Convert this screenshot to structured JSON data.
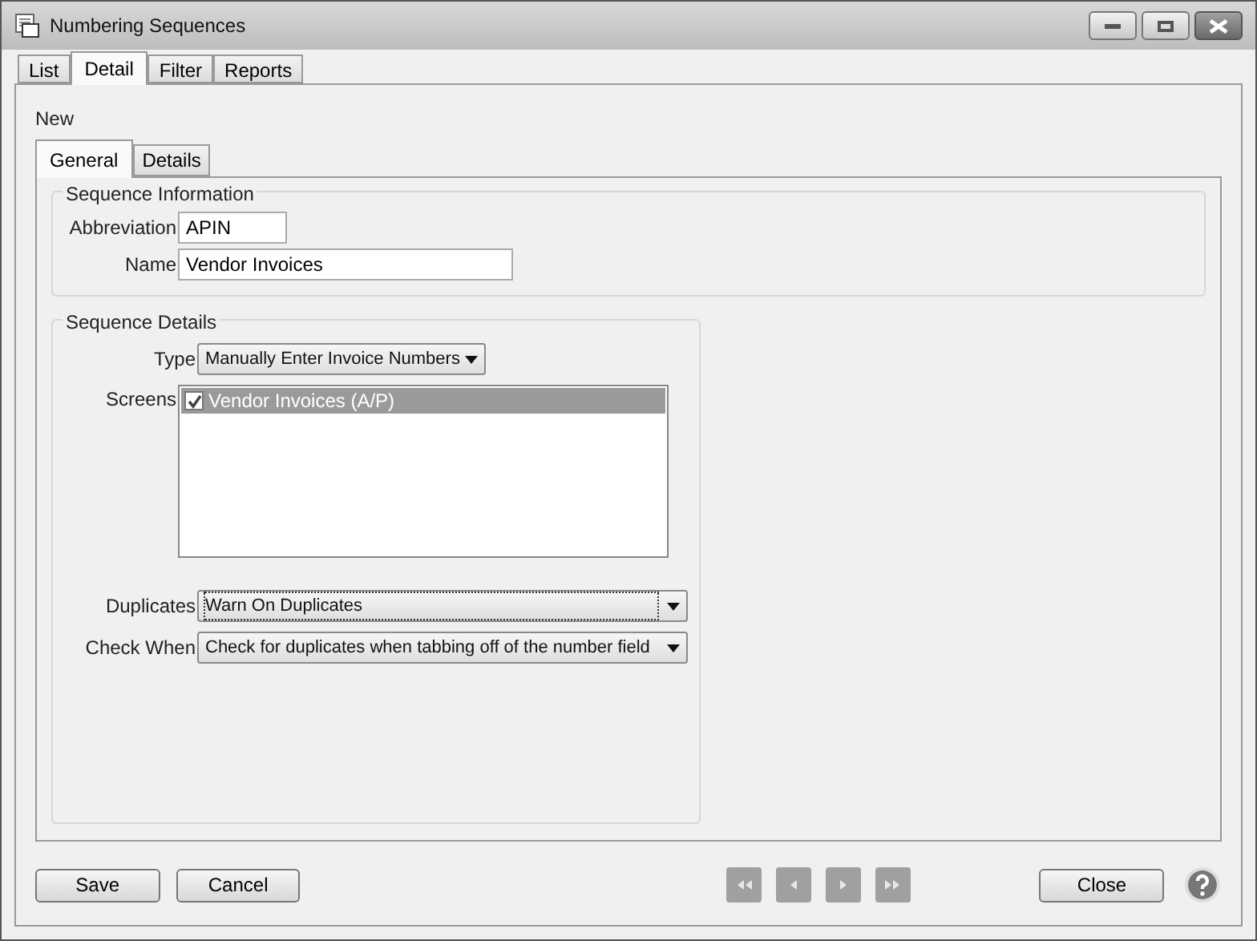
{
  "window": {
    "title": "Numbering Sequences"
  },
  "tabs": [
    {
      "label": "List",
      "selected": false
    },
    {
      "label": "Detail",
      "selected": true
    },
    {
      "label": "Filter",
      "selected": false
    },
    {
      "label": "Reports",
      "selected": false
    }
  ],
  "record_status": "New",
  "subtabs": [
    {
      "label": "General",
      "selected": true
    },
    {
      "label": "Details",
      "selected": false
    }
  ],
  "sequence_information": {
    "title": "Sequence Information",
    "abbreviation": {
      "label": "Abbreviation",
      "value": "APIN"
    },
    "name": {
      "label": "Name",
      "value": "Vendor Invoices"
    }
  },
  "sequence_details": {
    "title": "Sequence Details",
    "type": {
      "label": "Type",
      "value": "Manually Enter Invoice Numbers"
    },
    "screens": {
      "label": "Screens",
      "items": [
        {
          "label": "Vendor Invoices (A/P)",
          "checked": true,
          "selected": true
        }
      ]
    },
    "duplicates": {
      "label": "Duplicates",
      "value": "Warn On Duplicates"
    },
    "check_when": {
      "label": "Check When",
      "value": "Check for duplicates when tabbing off of the number field"
    }
  },
  "buttons": {
    "save": "Save",
    "cancel": "Cancel",
    "close": "Close"
  },
  "navigation": [
    {
      "kind": "first",
      "disabled": true
    },
    {
      "kind": "previous",
      "disabled": true
    },
    {
      "kind": "next",
      "disabled": true
    },
    {
      "kind": "last",
      "disabled": true
    }
  ]
}
